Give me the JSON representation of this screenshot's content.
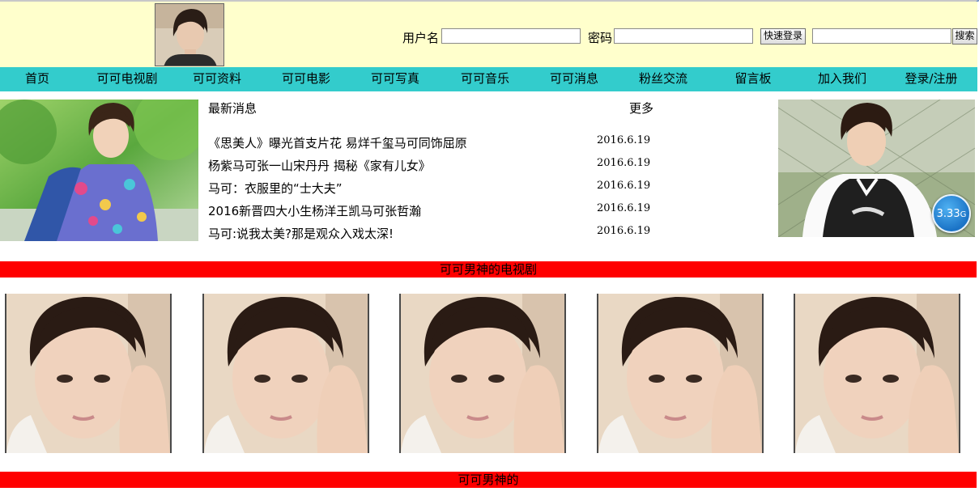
{
  "header": {
    "username_label": "用户名",
    "username_value": "",
    "password_label": "密码",
    "password_value": "",
    "quick_login_label": "快速登录",
    "search_value": "",
    "search_label": "搜索"
  },
  "nav": {
    "items": [
      {
        "label": "首页"
      },
      {
        "label": "可可电视剧"
      },
      {
        "label": "可可资料"
      },
      {
        "label": "可可电影"
      },
      {
        "label": "可可写真"
      },
      {
        "label": "可可音乐"
      },
      {
        "label": "可可消息"
      },
      {
        "label": "粉丝交流"
      },
      {
        "label": "留言板"
      },
      {
        "label": "加入我们"
      },
      {
        "label": "登录/注册"
      }
    ]
  },
  "news": {
    "title": "最新消息",
    "more_label": "更多",
    "items": [
      {
        "title": "《思美人》曝光首支片花 易烊千玺马可同饰屈原",
        "date": "2016.6.19"
      },
      {
        "title": "杨紫马可张一山宋丹丹 揭秘《家有儿女》",
        "date": "2016.6.19"
      },
      {
        "title": "马可：衣服里的“士大夫”",
        "date": "2016.6.19"
      },
      {
        "title": "2016新晋四大小生杨洋王凯马可张哲瀚",
        "date": "2016.6.19"
      },
      {
        "title": "马可:说我太美?那是观众入戏太深!",
        "date": "2016.6.19"
      }
    ]
  },
  "badge": {
    "value": "3.33",
    "unit": "G"
  },
  "sections": {
    "tv_title": "可可男神的电视剧",
    "second_title": "可可男神的"
  },
  "colors": {
    "header_bg": "#ffffcc",
    "nav_bg": "#33cccc",
    "section_bar": "#ff0000",
    "badge": "#1b73c6"
  },
  "icons": {
    "profile_photo": "portrait-photo",
    "gallery_photo": "portrait-photo"
  }
}
